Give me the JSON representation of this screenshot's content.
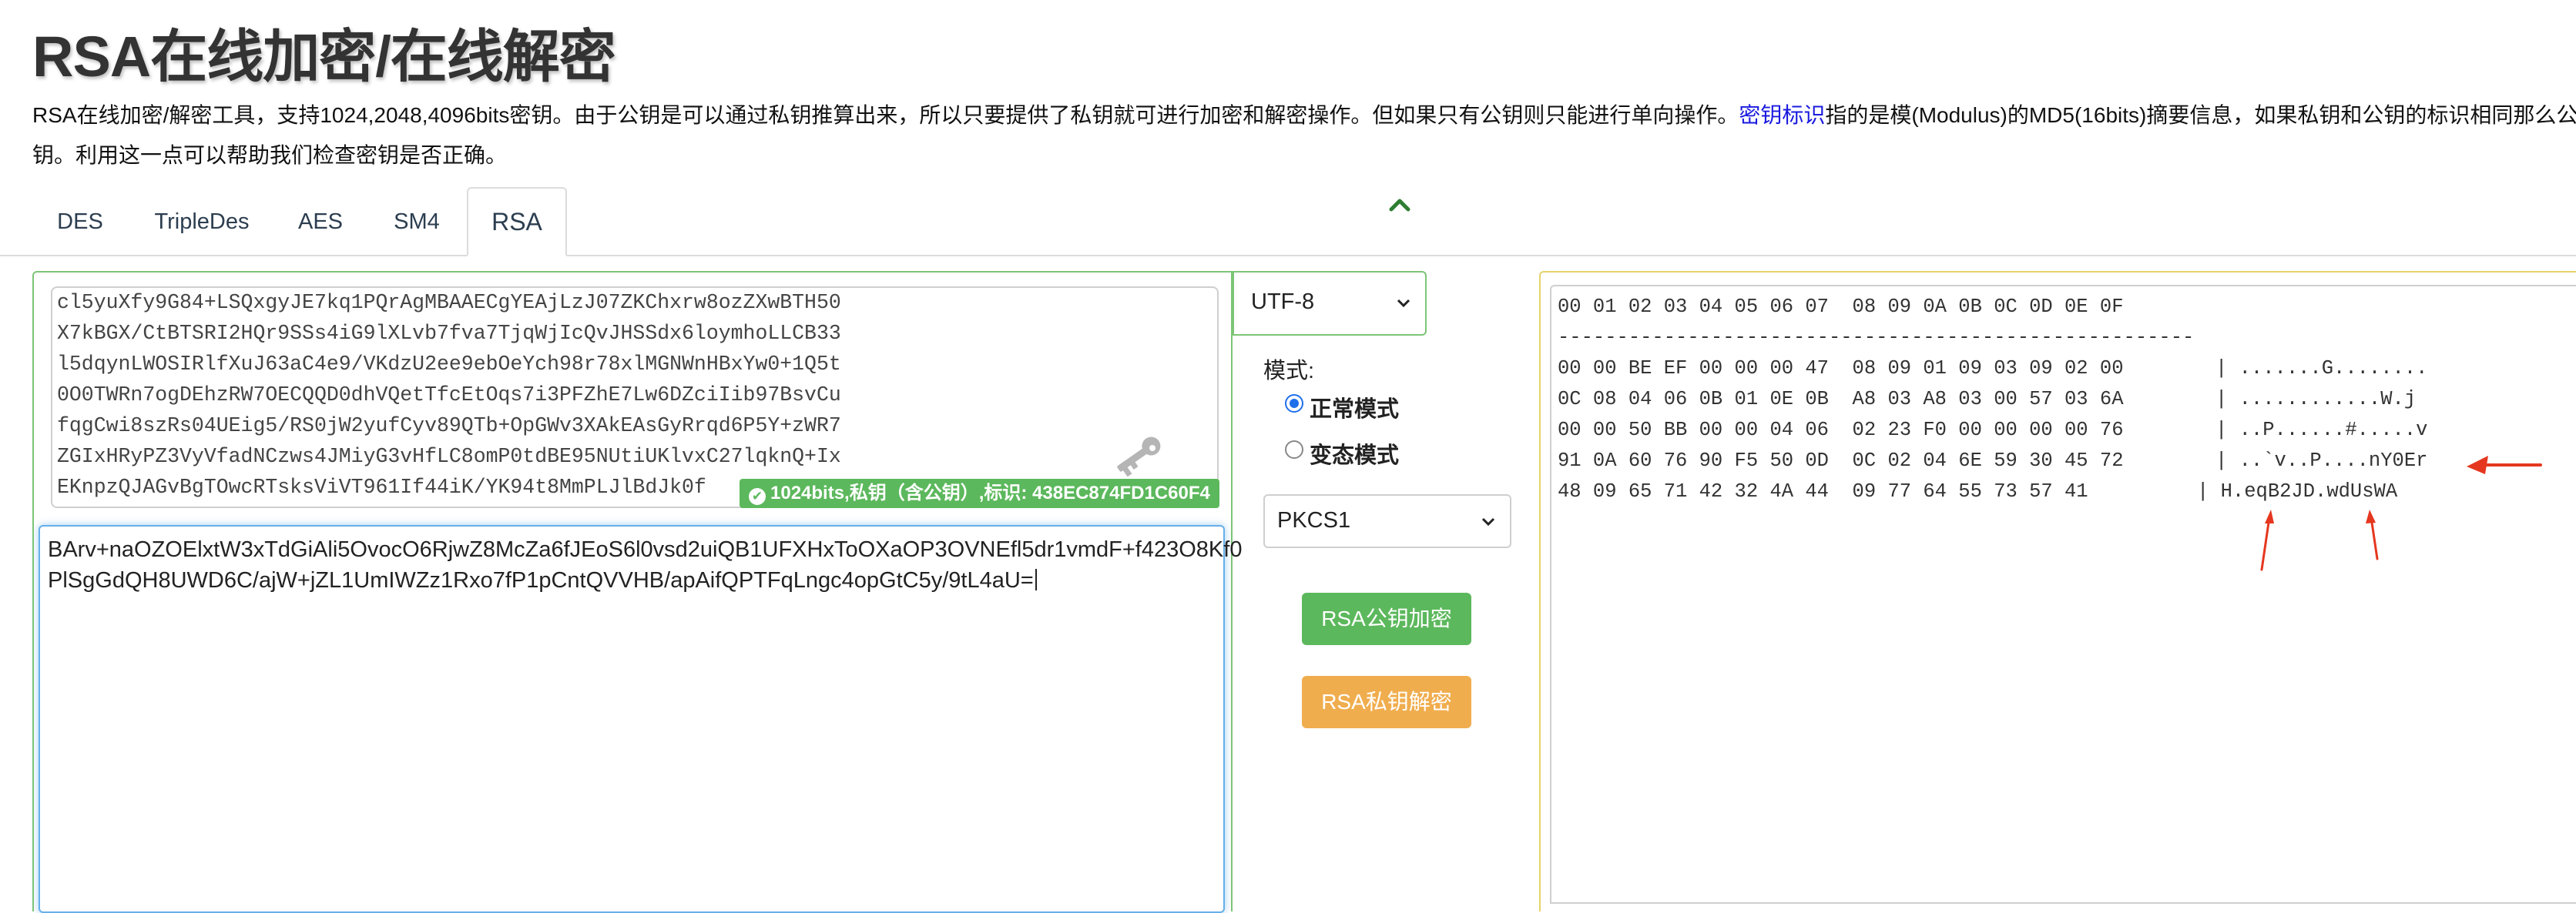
{
  "page": {
    "title": "RSA在线加密/在线解密",
    "desc_line1_a": "RSA在线加密/解密工具，支持1024,2048,4096bits密钥。由于公钥是可以通过私钥推算出来，所以只要提供了私钥就可进行加密和解密操作。但如果只有公钥则只能进行单向操作。",
    "desc_link": "密钥标识",
    "desc_line1_b": "指的是模(Modulus)的MD5(16bits)摘要信息，如果私钥和公钥的标识相同那么公",
    "desc_line2": "钥。利用这一点可以帮助我们检查密钥是否正确。"
  },
  "tabs": [
    {
      "label": "DES",
      "active": false
    },
    {
      "label": "TripleDes",
      "active": false
    },
    {
      "label": "AES",
      "active": false
    },
    {
      "label": "SM4",
      "active": false
    },
    {
      "label": "RSA",
      "active": true
    }
  ],
  "key_box": {
    "lines": [
      "cl5yuXfy9G84+LSQxgyJE7kq1PQrAgMBAAECgYEAjLzJ07ZKChxrw8ozZXwBTH50",
      "X7kBGX/CtBTSRI2HQr9SSs4iG9lXLvb7fva7TjqWjIcQvJHSSdx6loymhoLLCB33",
      "l5dqynLWOSIRlfXuJ63aC4e9/VKdzU2ee9ebOeYch98r78xlMGNWnHBxYw0+1Q5t",
      "0O0TWRn7ogDEhzRW7OECQQD0dhVQetTfcEtOqs7i3PFZhE7Lw6DZciIib97BsvCu",
      "fqgCwi8szRs04UEig5/RS0jW2yufCyv89QTb+OpGWv3XAkEAsGyRrqd6P5Y+zWR7",
      "ZGIxHRyPZ3VyVfadNCzws4JMiyG3vHfLC8omP0tdBE95NUtiUKlvxC27lqknQ+Ix",
      "EKnpzQJAGvBgTOwcRTsksViVT961If44iK/YK94t8MmPLJlBdJk0f"
    ],
    "badge": "1024bits,私钥（含公钥）,标识: 438EC874FD1C60F4"
  },
  "cipher_box": {
    "lines": [
      "BArv+naOZOElxtW3xTdGiAli5OvocO6RjwZ8McZa6fJEoS6l0vsd2uiQB1UFXHxToOXaOP3OVNEfl5dr1vmdF+f423O8Kf0",
      "PlSgGdQH8UWD6C/ajW+jZL1UmIWZz1Rxo7fP1pCntQVVHB/apAifQPTFqLngc4opGtC5y/9tL4aU="
    ]
  },
  "controls": {
    "encoding": "UTF-8",
    "mode_label": "模式:",
    "mode_normal": "正常模式",
    "mode_alt": "变态模式",
    "padding": "PKCS1",
    "encrypt_label": "RSA公钥加密",
    "decrypt_label": "RSA私钥解密"
  },
  "hex": {
    "header": "00 01 02 03 04 05 06 07  08 09 0A 0B 0C 0D 0E 0F",
    "separator": "------------------------------------------------------",
    "rows": [
      {
        "hex": "00 00 BE EF 00 00 00 47  08 09 01 09 03 09 02 00",
        "ascii": "| .......G........"
      },
      {
        "hex": "0C 08 04 06 0B 01 0E 0B  A8 03 A8 03 00 57 03 6A",
        "ascii": "| ............W.j"
      },
      {
        "hex": "00 00 50 BB 00 00 04 06  02 23 F0 00 00 00 00 76",
        "ascii": "| ..P......#.....v"
      },
      {
        "hex": "91 0A 60 76 90 F5 50 0D  0C 02 04 6E 59 30 45 72",
        "ascii": "| ..`v..P....nY0Er"
      },
      {
        "hex": "48 09 65 71 42 32 4A 44  09 77 64 55 73 57 41",
        "ascii": "| H.eqB2JD.wdUsWA"
      }
    ]
  },
  "colors": {
    "green": "#5cb85c",
    "orange": "#f0ad4e",
    "link": "#1a1adf",
    "arrow": "#e5371f"
  }
}
